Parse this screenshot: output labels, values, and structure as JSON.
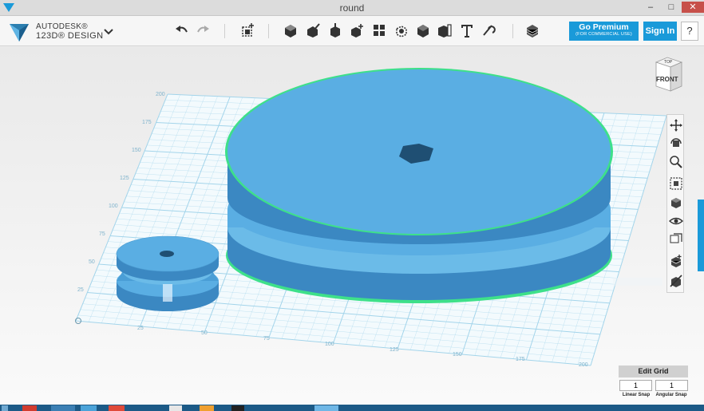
{
  "window": {
    "title": "round"
  },
  "brand": {
    "line1": "AUTODESK®",
    "line2": "123D® DESIGN"
  },
  "toolbar": {
    "tools": [
      "undo-icon",
      "redo-icon",
      "new-object-icon",
      "primitives-icon",
      "sketch-icon",
      "construct-icon",
      "modify-icon",
      "pattern-icon",
      "grouping-icon",
      "combine-icon",
      "measure-icon",
      "text-icon",
      "snap-icon",
      "material-icon"
    ]
  },
  "buttons": {
    "premium_label": "Go Premium",
    "premium_sub": "(FOR COMMERCIAL USE)",
    "signin_label": "Sign In",
    "help_label": "?"
  },
  "viewcube": {
    "top": "TOP",
    "front": "FRONT"
  },
  "grid": {
    "y_labels": [
      "200",
      "175",
      "150",
      "125",
      "100",
      "75",
      "50",
      "25"
    ],
    "x_labels": [
      "25",
      "50",
      "75",
      "100",
      "125",
      "150",
      "175",
      "200"
    ]
  },
  "grid_panel": {
    "edit_label": "Edit Grid",
    "linear_value": "1",
    "angular_value": "1",
    "linear_label": "Linear Snap",
    "angular_label": "Angular Snap"
  },
  "colors": {
    "accent": "#1a9ad9",
    "model": "#5aaee3",
    "grid": "#9fd3ea",
    "selection": "#3ee08a"
  }
}
